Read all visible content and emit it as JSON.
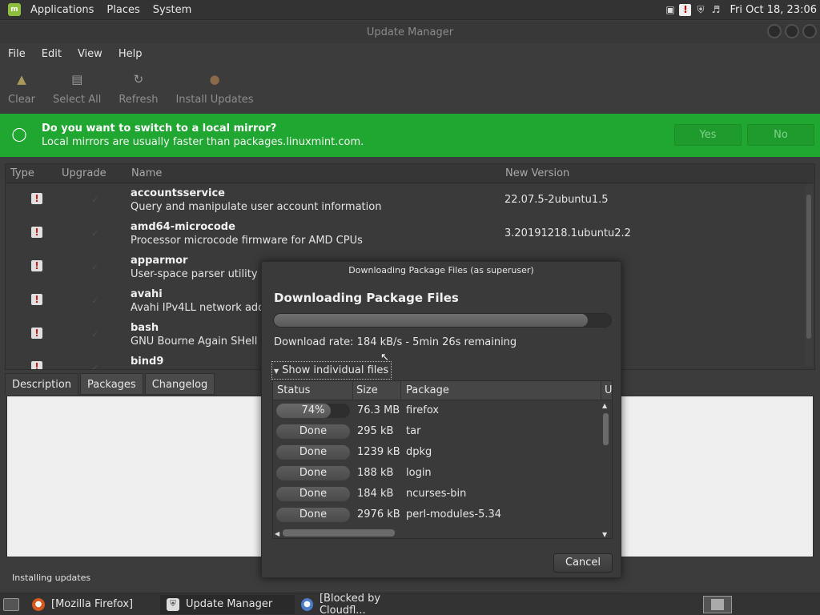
{
  "top_panel": {
    "menus": [
      "Applications",
      "Places",
      "System"
    ],
    "clock": "Fri Oct 18, 23:06"
  },
  "window": {
    "title": "Update Manager"
  },
  "menubar": [
    "File",
    "Edit",
    "View",
    "Help"
  ],
  "toolbar": {
    "clear": "Clear",
    "select_all": "Select All",
    "refresh": "Refresh",
    "install_updates": "Install Updates"
  },
  "infobar": {
    "question": "Do you want to switch to a local mirror?",
    "detail": "Local mirrors are usually faster than packages.linuxmint.com.",
    "yes": "Yes",
    "no": "No",
    "color": "#20a731"
  },
  "updates_table": {
    "columns": [
      "Type",
      "Upgrade",
      "Name",
      "New Version"
    ],
    "rows": [
      {
        "name": "accountsservice",
        "desc": "Query and manipulate user account information",
        "version": "22.07.5-2ubuntu1.5"
      },
      {
        "name": "amd64-microcode",
        "desc": "Processor microcode firmware for AMD CPUs",
        "version": "3.20191218.1ubuntu2.2"
      },
      {
        "name": "apparmor",
        "desc": "User-space parser utility for",
        "version": ""
      },
      {
        "name": "avahi",
        "desc": "Avahi IPv4LL network addr",
        "version": ""
      },
      {
        "name": "bash",
        "desc": "GNU Bourne Again SHell",
        "version": ""
      },
      {
        "name": "bind9",
        "desc": "",
        "version": ".04.1"
      }
    ]
  },
  "tabs": [
    "Description",
    "Packages",
    "Changelog"
  ],
  "status": "Installing updates",
  "dialog": {
    "title": "Downloading Package Files (as superuser)",
    "heading": "Downloading Package Files",
    "overall_progress": 0.93,
    "rate": "Download rate: 184 kB/s - 5min 26s remaining",
    "expander": "Show individual files",
    "columns": [
      "Status",
      "Size",
      "Package",
      "U"
    ],
    "files": [
      {
        "status": "74%",
        "progress": 0.74,
        "size": "76.3 MB",
        "package": "firefox"
      },
      {
        "status": "Done",
        "progress": 1.0,
        "size": "295 kB",
        "package": "tar"
      },
      {
        "status": "Done",
        "progress": 1.0,
        "size": "1239 kB",
        "package": "dpkg"
      },
      {
        "status": "Done",
        "progress": 1.0,
        "size": "188 kB",
        "package": "login"
      },
      {
        "status": "Done",
        "progress": 1.0,
        "size": "184 kB",
        "package": "ncurses-bin"
      },
      {
        "status": "Done",
        "progress": 1.0,
        "size": "2976 kB",
        "package": "perl-modules-5.34"
      }
    ],
    "cancel": "Cancel"
  },
  "taskbar": {
    "tasks": [
      "[Mozilla Firefox]",
      "Update Manager",
      "[Blocked by Cloudfl..."
    ]
  }
}
